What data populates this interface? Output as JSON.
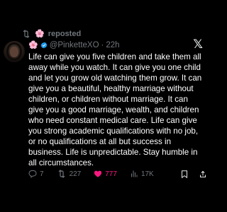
{
  "repost": {
    "label": "reposted",
    "flower": "🌸"
  },
  "post": {
    "flower": "🌸",
    "handle": "@PinketteXO",
    "separator": "·",
    "time": "22h",
    "text_lines": [
      "Life can give you five children and take them all",
      "away while you watch. It can give you one child",
      "and let you grow old watching them grow. It can",
      "give you a beautiful, healthy marriage without",
      "children, or children without marriage. It can",
      "give you a good marriage, wealth, and children",
      "who need constant medical care. Life can give",
      "you strong academic qualifications with no job,",
      "or no qualifications at all but success in",
      "business. Life is unpredictable. Stay humble in",
      "all circumstances."
    ]
  },
  "brand": {
    "logo": "𝕏"
  },
  "actions": {
    "replies": "7",
    "reposts": "227",
    "likes": "777",
    "views": "17K"
  },
  "colors": {
    "background": "#000000",
    "text": "#ffffff",
    "muted": "#71767b",
    "like": "#f91880",
    "verified": "#1d9bf0"
  },
  "icons": {
    "repost": "repost-icon",
    "verified": "verified-badge-icon",
    "reply": "reply-icon",
    "like": "heart-icon",
    "views": "views-chart-icon",
    "bookmark": "bookmark-icon",
    "share": "share-icon"
  }
}
